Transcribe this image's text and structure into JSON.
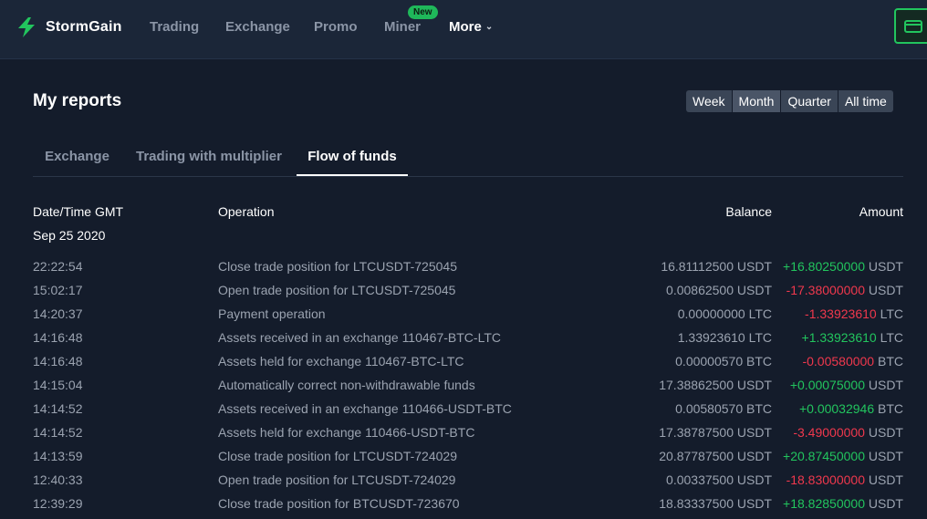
{
  "brand": {
    "name": "StormGain"
  },
  "nav": {
    "items": [
      {
        "label": "Trading"
      },
      {
        "label": "Exchange"
      },
      {
        "label": "Promo"
      },
      {
        "label": "Miner",
        "badge": "New"
      },
      {
        "label": "More"
      }
    ]
  },
  "page": {
    "title": "My reports"
  },
  "periods": [
    "Week",
    "Month",
    "Quarter",
    "All time"
  ],
  "selected_period": "Month",
  "tabs": [
    "Exchange",
    "Trading with multiplier",
    "Flow of funds"
  ],
  "active_tab": "Flow of funds",
  "table": {
    "headers": {
      "datetime": "Date/Time GMT",
      "operation": "Operation",
      "balance": "Balance",
      "amount": "Amount"
    },
    "date_group": "Sep 25 2020",
    "rows": [
      {
        "time": "22:22:54",
        "operation": "Close trade position for LTCUSDT-725045",
        "balance": "16.81112500 USDT",
        "amount": "+16.80250000",
        "currency": "USDT",
        "sign": "pos"
      },
      {
        "time": "15:02:17",
        "operation": "Open trade position for LTCUSDT-725045",
        "balance": "0.00862500 USDT",
        "amount": "-17.38000000",
        "currency": "USDT",
        "sign": "neg"
      },
      {
        "time": "14:20:37",
        "operation": "Payment operation",
        "balance": "0.00000000 LTC",
        "amount": "-1.33923610",
        "currency": "LTC",
        "sign": "neg"
      },
      {
        "time": "14:16:48",
        "operation": "Assets received in an exchange 110467-BTC-LTC",
        "balance": "1.33923610 LTC",
        "amount": "+1.33923610",
        "currency": "LTC",
        "sign": "pos"
      },
      {
        "time": "14:16:48",
        "operation": "Assets held for exchange 110467-BTC-LTC",
        "balance": "0.00000570 BTC",
        "amount": "-0.00580000",
        "currency": "BTC",
        "sign": "neg"
      },
      {
        "time": "14:15:04",
        "operation": "Automatically correct non-withdrawable funds",
        "balance": "17.38862500 USDT",
        "amount": "+0.00075000",
        "currency": "USDT",
        "sign": "pos"
      },
      {
        "time": "14:14:52",
        "operation": "Assets received in an exchange 110466-USDT-BTC",
        "balance": "0.00580570 BTC",
        "amount": "+0.00032946",
        "currency": "BTC",
        "sign": "pos"
      },
      {
        "time": "14:14:52",
        "operation": "Assets held for exchange 110466-USDT-BTC",
        "balance": "17.38787500 USDT",
        "amount": "-3.49000000",
        "currency": "USDT",
        "sign": "neg"
      },
      {
        "time": "14:13:59",
        "operation": "Close trade position for LTCUSDT-724029",
        "balance": "20.87787500 USDT",
        "amount": "+20.87450000",
        "currency": "USDT",
        "sign": "pos"
      },
      {
        "time": "12:40:33",
        "operation": "Open trade position for LTCUSDT-724029",
        "balance": "0.00337500 USDT",
        "amount": "-18.83000000",
        "currency": "USDT",
        "sign": "neg"
      },
      {
        "time": "12:39:29",
        "operation": "Close trade position for BTCUSDT-723670",
        "balance": "18.83337500 USDT",
        "amount": "+18.82850000",
        "currency": "USDT",
        "sign": "pos"
      }
    ]
  },
  "colors": {
    "positive": "#22c55e",
    "negative": "#f0384d",
    "accent": "#22c55e",
    "background": "#141c2b"
  },
  "icons": {
    "logo": "stormgain-bolt-icon",
    "wallet": "wallet-icon",
    "more": "chevron-down-icon"
  }
}
